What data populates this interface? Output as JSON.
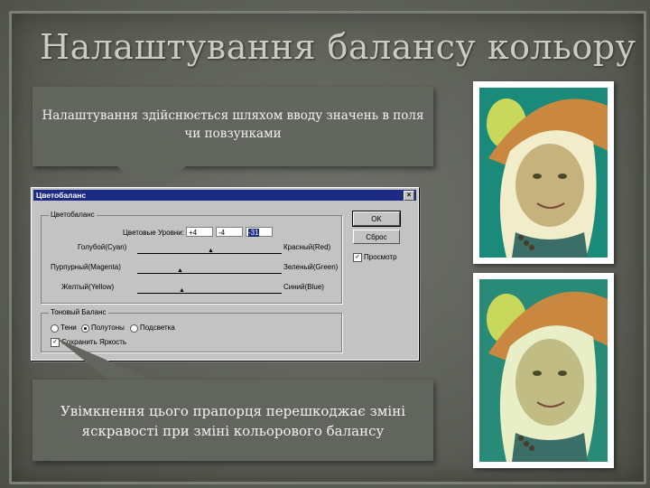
{
  "slide": {
    "title": "Налаштування балансу кольору",
    "callout_top": "Налаштування здійснюється шляхом вводу значень в поля чи повзунками",
    "callout_bottom": "Увімкнення цього прапорця перешкоджає зміні яскравості при зміні кольорового балансу"
  },
  "dialog": {
    "title": "Цветобаланс",
    "close": "×",
    "group_color": "Цветобаланс",
    "levels_label": "Цветовые Уровни:",
    "levels": [
      "+4",
      "-4",
      "-31"
    ],
    "left_labels": [
      "Голубой(Cyan)",
      "Пурпурный(Magenta)",
      "Желтый(Yellow)"
    ],
    "right_labels": [
      "Красный(Red)",
      "Зеленый(Green)",
      "Синий(Blue)"
    ],
    "group_tone": "Тоновый Баланс",
    "tones": [
      "Тени",
      "Полутоны",
      "Подсветка"
    ],
    "selected_tone": "Полутоны",
    "preserve_luminosity": "Сохранить Яркость",
    "ok": "OK",
    "reset": "Сброс",
    "preview": "Просмотр"
  },
  "colors": {
    "background": "#5e6159",
    "callout": "#62655e",
    "dialog": "#c3c3c3",
    "titlebar": "#1c2c86"
  }
}
